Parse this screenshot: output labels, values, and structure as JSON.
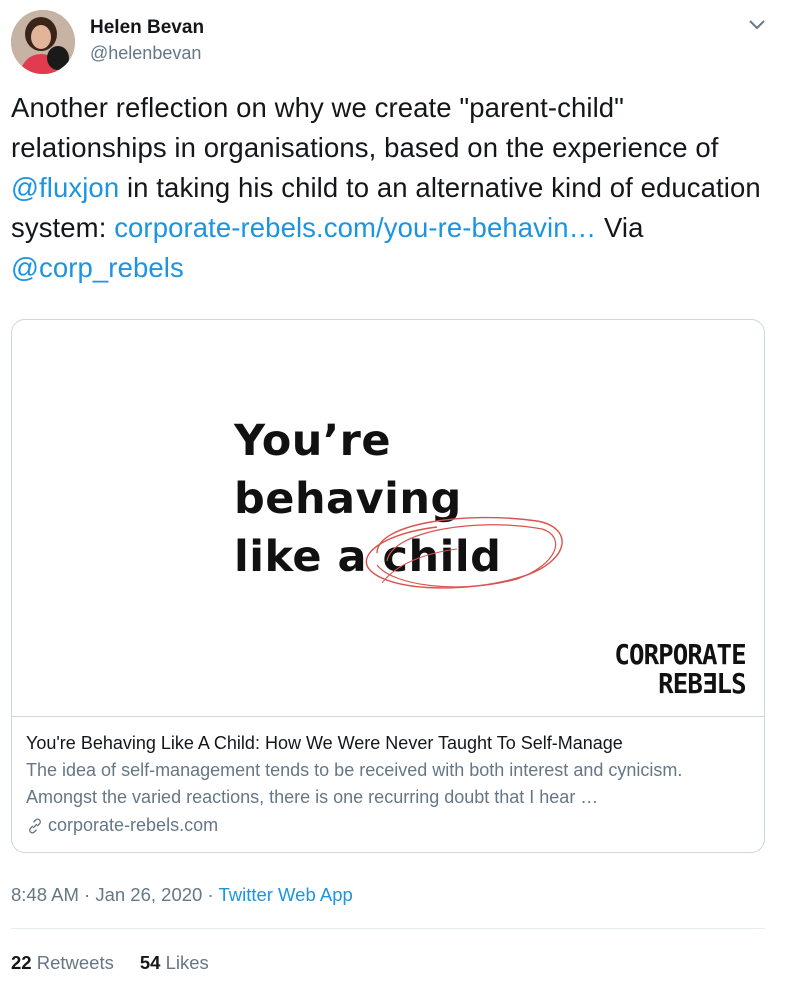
{
  "user": {
    "name": "Helen Bevan",
    "handle": "@helenbevan"
  },
  "tweet": {
    "text_1": "Another reflection on why we create \"parent-child\" relationships in organisations, based on the experience of ",
    "mention_1": "@fluxjon",
    "text_2": " in taking his child to an alternative kind of education system: ",
    "link": "corporate-rebels.com/you-re-behavin…",
    "text_3": " Via ",
    "mention_2": "@corp_rebels"
  },
  "card": {
    "image": {
      "line_1": "You’re",
      "line_2": "behaving",
      "line_3": "like a child",
      "brand_line_1": "CORPORATE",
      "brand_line_2": "REBƎLS"
    },
    "title": "You're Behaving Like A Child: How We Were Never Taught To Self-Manage",
    "description": "The idea of self-management tends to be received with both interest and cynicism. Amongst the varied reactions, there is one recurring doubt that I hear …",
    "domain": "corporate-rebels.com",
    "colors": {
      "scribble": "#d9534f"
    }
  },
  "meta": {
    "time": "8:48 AM",
    "separator": " · ",
    "date": "Jan 26, 2020",
    "source": "Twitter Web App"
  },
  "stats": {
    "retweets_count": "22",
    "retweets_label": "Retweets",
    "likes_count": "54",
    "likes_label": "Likes"
  },
  "colors": {
    "link": "#1b95e0",
    "secondary_text": "#657786",
    "border": "#ccd6dd"
  }
}
